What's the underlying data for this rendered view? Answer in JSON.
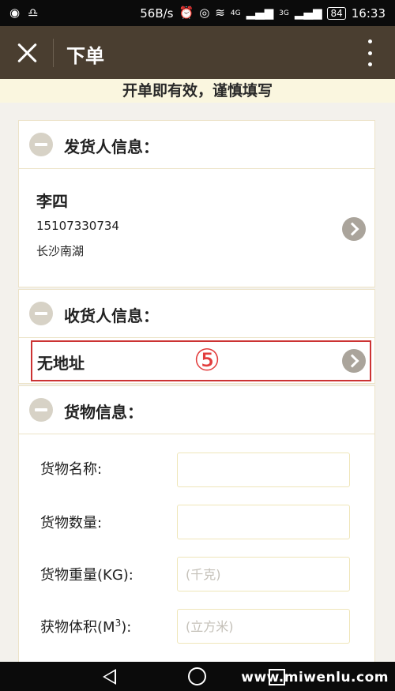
{
  "status_bar": {
    "speed": "56B/s",
    "net_1": "4G",
    "net_2": "3G",
    "battery": "84",
    "time": "16:33"
  },
  "header": {
    "title": "下单"
  },
  "notice": "开单即有效，谨慎填写",
  "sender": {
    "section_title": "发货人信息：",
    "name": "李四",
    "phone": "15107330734",
    "address": "长沙南湖"
  },
  "receiver": {
    "section_title": "收货人信息：",
    "address_text": "无地址",
    "step_marker": "⑤"
  },
  "goods": {
    "section_title": "货物信息：",
    "fields": [
      {
        "label": "货物名称:",
        "value": "",
        "placeholder": ""
      },
      {
        "label": "货物数量:",
        "value": "",
        "placeholder": ""
      },
      {
        "label": "货物重量(KG):",
        "value": "",
        "placeholder": "(千克)"
      },
      {
        "label_prefix": "获物体积(M",
        "label_sup": "3",
        "label_suffix": "):",
        "value": "",
        "placeholder": "(立方米)"
      }
    ]
  },
  "watermark": "www.miwenlu.com"
}
